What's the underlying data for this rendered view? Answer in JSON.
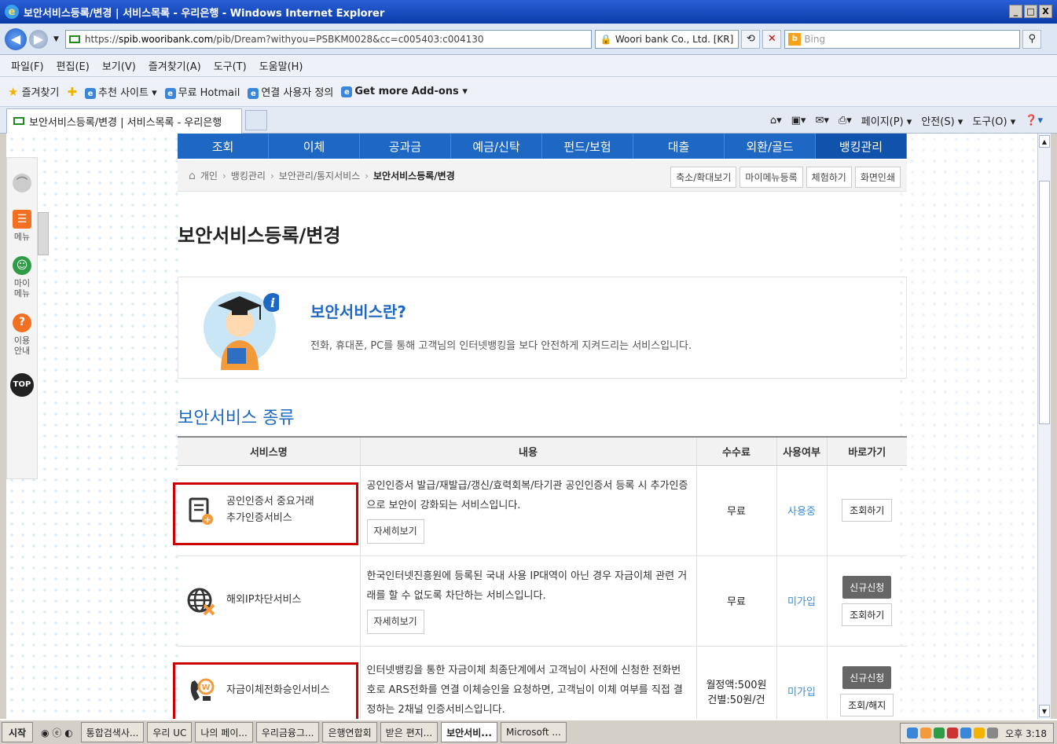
{
  "window": {
    "title": "보안서비스등록/변경 | 서비스목록 - 우리은행 - Windows Internet Explorer",
    "controls": [
      "_",
      "□",
      "X"
    ]
  },
  "address": {
    "url_prefix": "https://",
    "url_host": "spib.wooribank.com",
    "url_path": "/pib/Dream?withyou=PSBKM0028&cc=c005403:c004130",
    "cert": "Woori bank Co., Ltd. [KR]",
    "search_placeholder": "Bing"
  },
  "menu": [
    "파일(F)",
    "편집(E)",
    "보기(V)",
    "즐겨찾기(A)",
    "도구(T)",
    "도움말(H)"
  ],
  "favorites": {
    "label": "즐겨찾기",
    "items": [
      "추천 사이트 ▾",
      "무료 Hotmail",
      "연결 사용자 정의",
      "Get more Add-ons ▾"
    ]
  },
  "tab": {
    "title": "보안서비스등록/변경 | 서비스목록 - 우리은행"
  },
  "commands": [
    "페이지(P) ▾",
    "안전(S) ▾",
    "도구(O) ▾"
  ],
  "quickmenu": {
    "items": [
      {
        "label": "메뉴"
      },
      {
        "label": "마이메뉴"
      },
      {
        "label": "이용안내"
      }
    ],
    "top": "TOP"
  },
  "gnb": [
    "조회",
    "이체",
    "공과금",
    "예금/신탁",
    "펀드/보험",
    "대출",
    "외환/골드",
    "뱅킹관리"
  ],
  "breadcrumb": {
    "items": [
      "개인",
      "뱅킹관리",
      "보안관리/통지서비스",
      "보안서비스등록/변경"
    ],
    "buttons": [
      "축소/확대보기",
      "마이메뉴등록",
      "체험하기",
      "화면인쇄"
    ]
  },
  "page_title": "보안서비스등록/변경",
  "intro": {
    "title": "보안서비스란?",
    "desc": "전화, 휴대폰, PC를 통해 고객님의 인터넷뱅킹을 보다 안전하게 지켜드리는 서비스입니다."
  },
  "section_title": "보안서비스 종류",
  "table": {
    "headers": [
      "서비스명",
      "내용",
      "수수료",
      "사용여부",
      "바로가기"
    ],
    "rows": [
      {
        "name_line1": "공인인증서 중요거래",
        "name_line2": "추가인증서비스",
        "desc": "공인인증서 발급/재발급/갱신/효력회복/타기관 공인인증서 등록 시 추가인증으로 보안이 강화되는 서비스입니다.",
        "detail": "자세히보기",
        "fee": "무료",
        "use": "사용중",
        "btn1": "조회하기"
      },
      {
        "name_line1": "해외IP차단서비스",
        "desc": "한국인터넷진흥원에 등록된 국내 사용 IP대역이 아닌 경우 자금이체 관련 거래를 할 수 없도록 차단하는 서비스입니다.",
        "detail": "자세히보기",
        "fee": "무료",
        "use": "미가입",
        "btn_new": "신규신청",
        "btn1": "조회하기"
      },
      {
        "name_line1": "자금이체전화승인서비스",
        "desc": "인터넷뱅킹을 통한 자금이체 최종단계에서 고객님이 사전에 신청한 전화번호로 ARS전화를 연결 이체승인을 요청하면, 고객님이 이체 여부를 직접 결정하는 2채널 인증서비스입니다.",
        "fee_line1": "월정액:500원",
        "fee_line2": "건별:50원/건",
        "use": "미가입",
        "btn_new": "신규신청",
        "btn1": "조회/해지"
      }
    ]
  },
  "taskbar": {
    "start": "시작",
    "items": [
      "통합검색사...",
      "우리 UC",
      "나의 페이...",
      "우리금융그...",
      "은행연합회",
      "받은 편지...",
      "보안서비...",
      "Microsoft ..."
    ],
    "clock": "오후 3:18"
  },
  "colors": {
    "accent": "#1e68c4",
    "highlight": "#cc0000"
  }
}
